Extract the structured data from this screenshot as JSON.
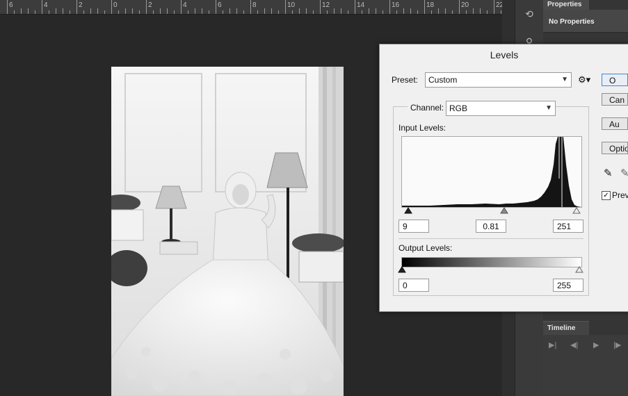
{
  "ruler": {
    "labels": [
      "6",
      "4",
      "2",
      "0",
      "2",
      "4",
      "6",
      "8",
      "10",
      "12",
      "14",
      "16",
      "18",
      "20",
      "22"
    ]
  },
  "properties_panel": {
    "tab_label": "Properties",
    "status": "No Properties"
  },
  "timeline_panel": {
    "tab_label": "Timeline"
  },
  "levels_dialog": {
    "title": "Levels",
    "preset_label": "Preset:",
    "preset_value": "Custom",
    "channel_label": "Channel:",
    "channel_value": "RGB",
    "input_levels_label": "Input Levels:",
    "input_black": "9",
    "input_gamma": "0.81",
    "input_white": "251",
    "output_levels_label": "Output Levels:",
    "output_black": "0",
    "output_white": "255",
    "buttons": {
      "ok": "O",
      "cancel": "Can",
      "auto": "Au",
      "options": "Optio"
    },
    "preview_label": "Prev",
    "preview_checked": true
  }
}
